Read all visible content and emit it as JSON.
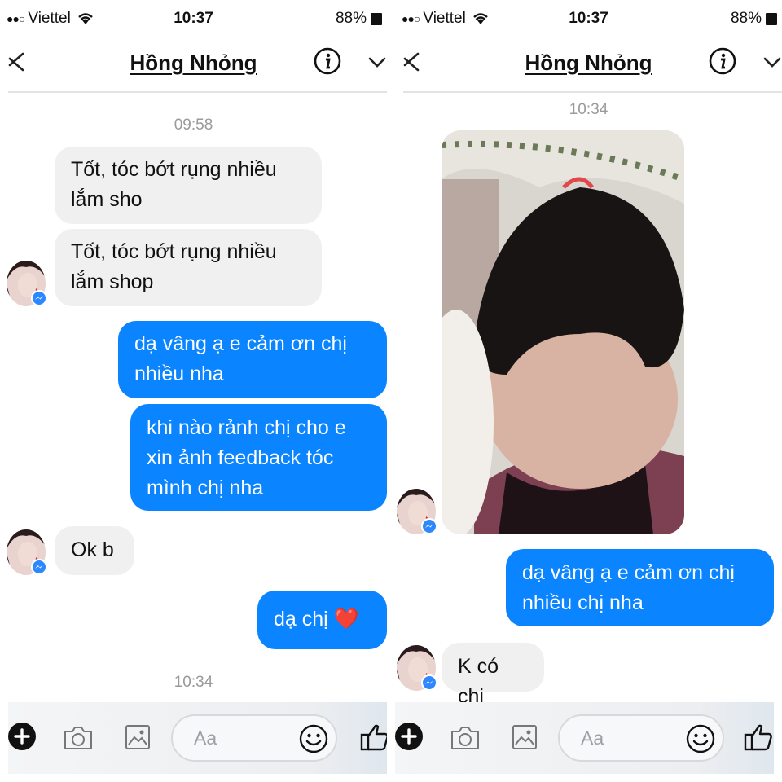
{
  "status_bar": {
    "carrier": "Viettel",
    "time": "10:37",
    "battery": "88%"
  },
  "header": {
    "title": "Hồng Nhỏng"
  },
  "composer": {
    "placeholder": "Aa"
  },
  "left_screen": {
    "timestamp_top": "09:58",
    "messages": [
      {
        "from": "contact",
        "text_lines": [
          "Tốt, tóc bớt rụng nhiều",
          "lắm sho"
        ]
      },
      {
        "from": "contact",
        "text_lines": [
          "Tốt, tóc bớt rụng nhiều",
          "lắm shop"
        ]
      },
      {
        "from": "me",
        "text_lines": [
          "dạ vâng ạ e cảm ơn chị",
          "nhiều nha"
        ]
      },
      {
        "from": "me",
        "text_lines": [
          "khi nào rảnh chị cho e",
          "xin ảnh feedback tóc",
          "mình chị nha"
        ]
      },
      {
        "from": "contact",
        "text_lines": [
          "Ok b"
        ]
      },
      {
        "from": "me",
        "text_lines": [
          "dạ chị ❤️"
        ]
      }
    ],
    "timestamp_bottom": "10:34"
  },
  "right_screen": {
    "timestamp_top": "10:34",
    "messages": [
      {
        "from": "contact",
        "type": "photo"
      },
      {
        "from": "me",
        "text_lines": [
          "dạ vâng ạ e cảm ơn chị",
          "nhiều chị nha"
        ]
      },
      {
        "from": "contact",
        "text_lines": [
          "K có chi"
        ]
      }
    ]
  },
  "icons": {
    "back": "close-x-icon",
    "info": "info-icon",
    "chevron": "chevron-down-icon",
    "plus": "plus-circle-icon",
    "camera": "camera-icon",
    "gallery": "image-icon",
    "emoji": "smiley-icon",
    "like": "thumbs-up-icon",
    "messenger_badge": "messenger-badge-icon"
  },
  "colors": {
    "outgoing_bubble": "#0a84ff",
    "incoming_bubble": "#f0f0f0",
    "timestamp": "#9a9a9a"
  }
}
